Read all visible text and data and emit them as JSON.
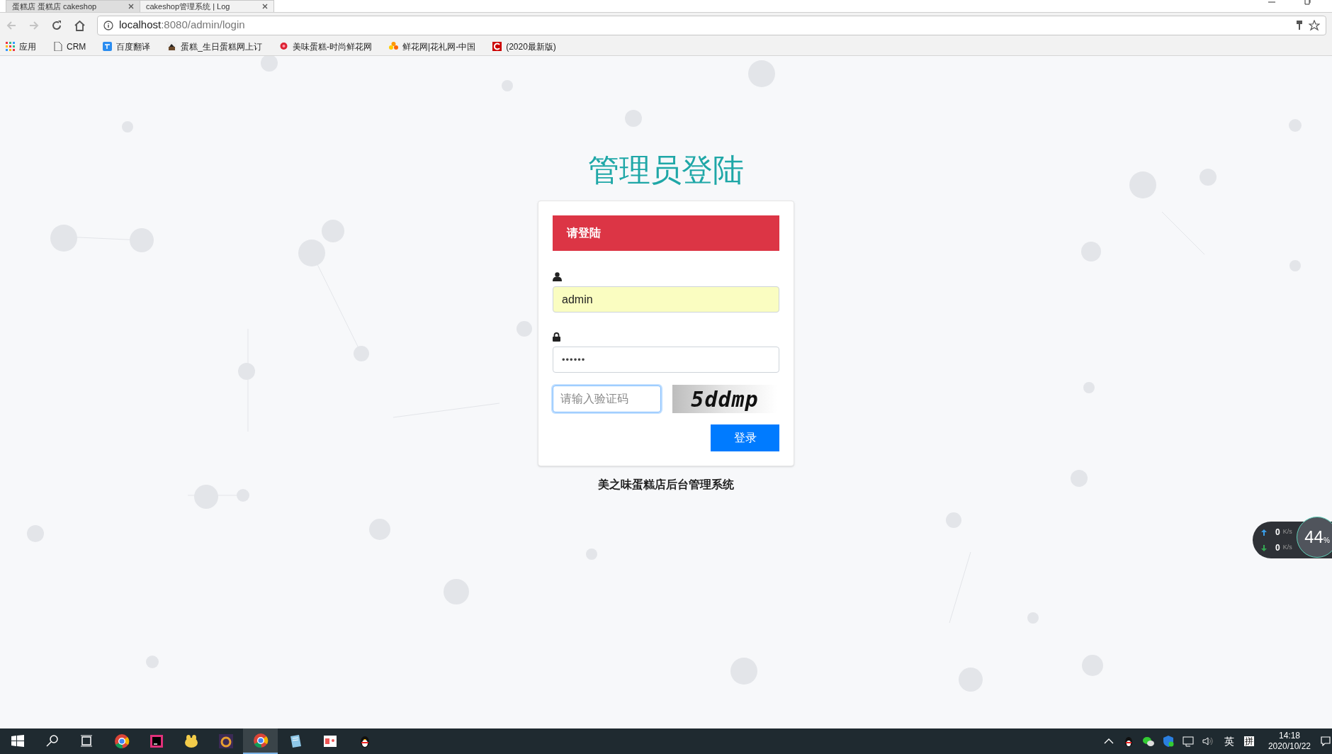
{
  "browser": {
    "tabs": [
      {
        "title": "蛋糕店 蛋糕店 cakeshop",
        "selected": false
      },
      {
        "title": "cakeshop管理系统 | Log",
        "selected": true
      }
    ],
    "url_host": "localhost",
    "url_rest": ":8080/admin/login",
    "bookmarks": [
      {
        "label": "应用",
        "kind": "apps"
      },
      {
        "label": "CRM",
        "kind": "page"
      },
      {
        "label": "百度翻译",
        "kind": "translate"
      },
      {
        "label": "蛋糕_生日蛋糕网上订",
        "kind": "cake"
      },
      {
        "label": "美味蛋糕-时尚鲜花网",
        "kind": "rose"
      },
      {
        "label": "鲜花网|花礼网-中国",
        "kind": "flower"
      },
      {
        "label": "(2020最新版)",
        "kind": "red-c"
      }
    ]
  },
  "login": {
    "heading": "管理员登陆",
    "alert": "请登陆",
    "username": {
      "value": "admin",
      "autofilled": true
    },
    "password": {
      "value": "••••••"
    },
    "captcha": {
      "placeholder": "请输入验证码",
      "focused": true
    },
    "captcha_image_text": "5ddmp",
    "submit": "登录",
    "footer": "美之味蛋糕店后台管理系统"
  },
  "speed_widget": {
    "up": {
      "value": "0",
      "unit": "K/s"
    },
    "down": {
      "value": "0",
      "unit": "K/s"
    },
    "percent": "44",
    "percent_sign": "%"
  },
  "taskbar": {
    "apps": [
      {
        "kind": "start",
        "active": false
      },
      {
        "kind": "search",
        "active": false
      },
      {
        "kind": "taskview",
        "active": false
      },
      {
        "kind": "chrome",
        "active": false
      },
      {
        "kind": "ide",
        "active": false
      },
      {
        "kind": "yellow",
        "active": false
      },
      {
        "kind": "javaee",
        "active": false
      },
      {
        "kind": "chrome",
        "active": true
      },
      {
        "kind": "notepad",
        "active": false
      },
      {
        "kind": "slides",
        "active": false
      },
      {
        "kind": "penguin",
        "active": false
      }
    ],
    "tray": [
      {
        "kind": "chevron"
      },
      {
        "kind": "penguin"
      },
      {
        "kind": "chat"
      },
      {
        "kind": "shield"
      },
      {
        "kind": "network"
      },
      {
        "kind": "volume"
      }
    ],
    "ime_lang": "英",
    "ime_mode": "拼",
    "time": "14:18",
    "date": "2020/10/22"
  }
}
